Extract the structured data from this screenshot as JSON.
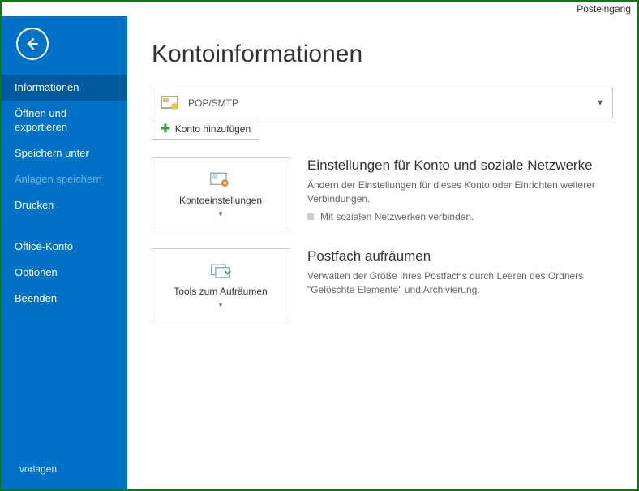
{
  "titlebar": {
    "label": "Posteingang"
  },
  "sidebar": {
    "items": [
      {
        "label": "Informationen",
        "state": "active"
      },
      {
        "label": "Öffnen und exportieren",
        "state": "normal"
      },
      {
        "label": "Speichern unter",
        "state": "normal"
      },
      {
        "label": "Anlagen speichern",
        "state": "disabled"
      },
      {
        "label": "Drucken",
        "state": "normal"
      },
      {
        "label": "Office-Konto",
        "state": "normal"
      },
      {
        "label": "Optionen",
        "state": "normal"
      },
      {
        "label": "Beenden",
        "state": "normal"
      }
    ],
    "bottom": "vorlagen"
  },
  "main": {
    "title": "Kontoinformationen",
    "account_selector": {
      "value": "POP/SMTP"
    },
    "add_account_label": "Konto hinzufügen",
    "sections": [
      {
        "tile_label": "Kontoeinstellungen",
        "heading": "Einstellungen für Konto und soziale Netzwerke",
        "desc": "Ändern der Einstellungen für dieses Konto oder Einrichten weiterer Verbindungen.",
        "link": "Mit sozialen Netzwerken verbinden."
      },
      {
        "tile_label": "Tools zum Aufräumen",
        "heading": "Postfach aufräumen",
        "desc": "Verwalten der Größe Ihres Postfachs durch Leeren des Ordners \"Gelöschte Elemente\" und Archivierung."
      }
    ]
  }
}
